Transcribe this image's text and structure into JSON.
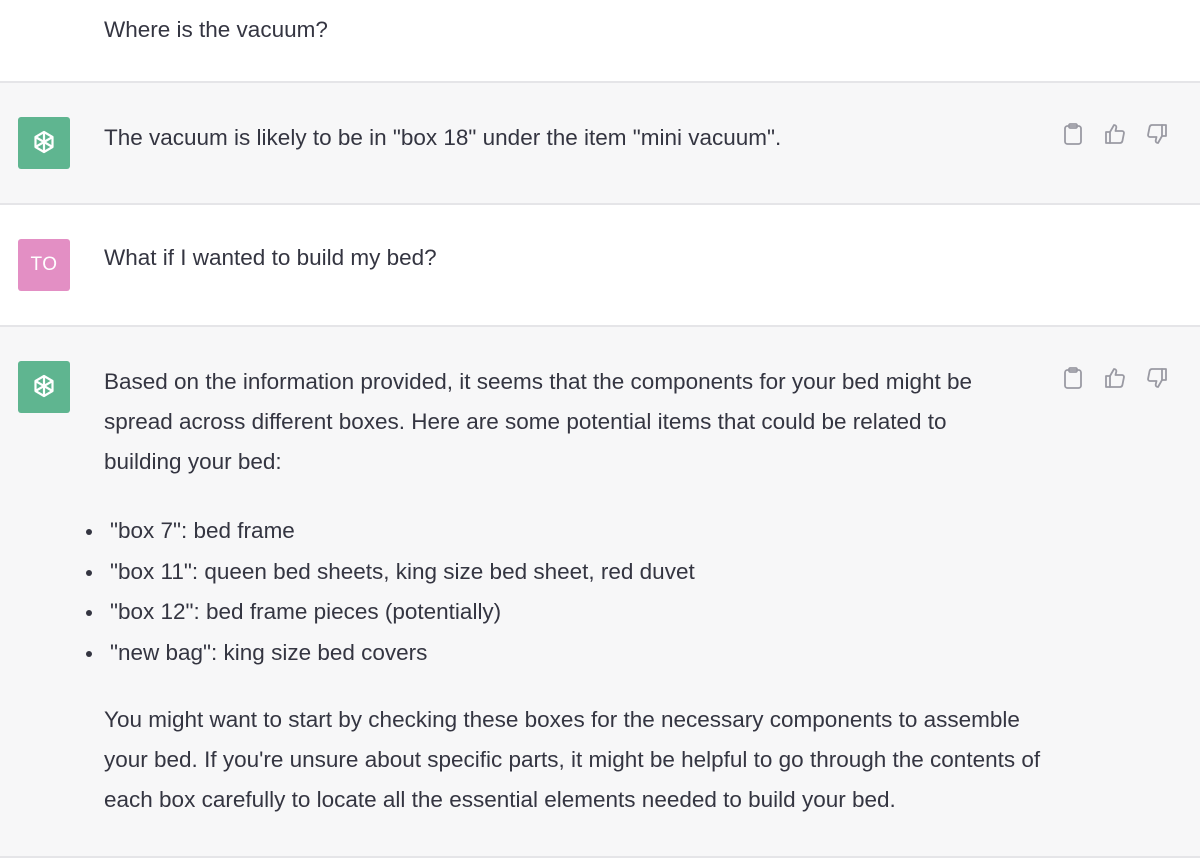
{
  "conversation": {
    "messages": [
      {
        "role": "user",
        "text": "Where is the vacuum?"
      },
      {
        "role": "assistant",
        "text": "The vacuum is likely to be in \"box 18\" under the item \"mini vacuum\"."
      },
      {
        "role": "user",
        "avatar_initials": "TO",
        "text": "What if I wanted to build my bed?"
      },
      {
        "role": "assistant",
        "intro": "Based on the information provided, it seems that the components for your bed might be spread across different boxes. Here are some potential items that could be related to building your bed:",
        "bullets": [
          "\"box 7\": bed frame",
          "\"box 11\": queen bed sheets, king size bed sheet, red duvet",
          "\"box 12\": bed frame pieces (potentially)",
          "\"new bag\": king size bed covers"
        ],
        "outro": "You might want to start by checking these boxes for the necessary components to assemble your bed. If you're unsure about specific parts, it might be helpful to go through the contents of each box carefully to locate all the essential elements needed to build your bed."
      }
    ]
  },
  "icons": {
    "assistant_avatar": "openai-logo-icon",
    "copy": "clipboard-icon",
    "like": "thumbs-up-icon",
    "dislike": "thumbs-down-icon"
  },
  "colors": {
    "assistant_bg": "#f7f7f8",
    "user_bg": "#ffffff",
    "assistant_avatar": "#5fb590",
    "user_avatar": "#e38fc4",
    "text": "#343541"
  }
}
